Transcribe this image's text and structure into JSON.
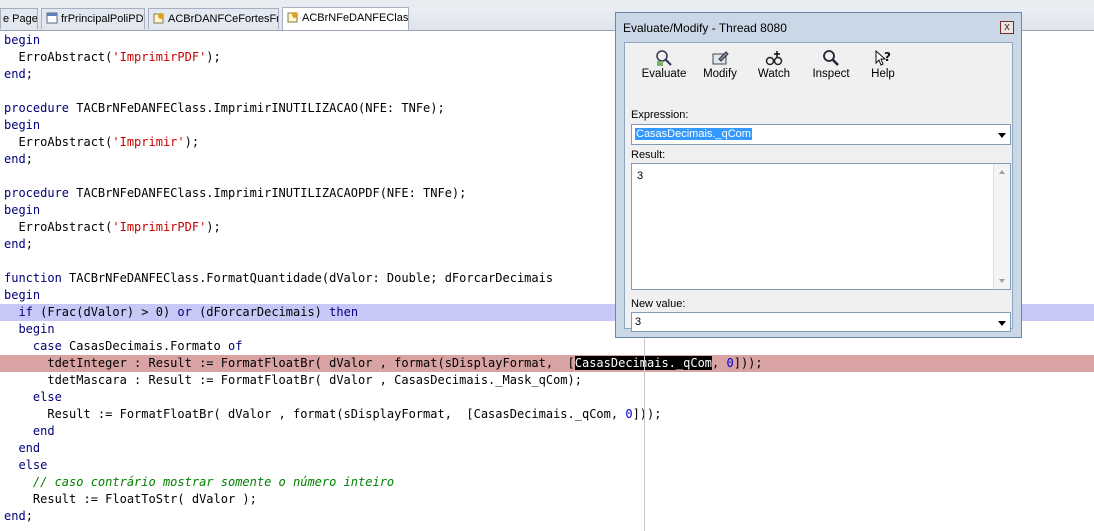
{
  "tabs": [
    {
      "label": "e Page",
      "icon": "none"
    },
    {
      "label": "frPrincipalPoliPDV",
      "icon": "form-icon"
    },
    {
      "label": "ACBrDANFCeFortesFr",
      "icon": "unit-icon"
    },
    {
      "label": "ACBrNFeDANFEClass",
      "icon": "unit-icon"
    }
  ],
  "code_lines": [
    [
      {
        "t": "begin",
        "c": "kw"
      }
    ],
    [
      {
        "t": "  ErroAbstract("
      },
      {
        "t": "'ImprimirPDF'",
        "c": "str"
      },
      {
        "t": ");"
      }
    ],
    [
      {
        "t": "end",
        "c": "kw"
      },
      {
        "t": ";"
      }
    ],
    [
      {
        "t": ""
      }
    ],
    [
      {
        "t": "procedure",
        "c": "kw"
      },
      {
        "t": " TACBrNFeDANFEClass.ImprimirINUTILIZACAO(NFE: TNFe);"
      }
    ],
    [
      {
        "t": "begin",
        "c": "kw"
      }
    ],
    [
      {
        "t": "  ErroAbstract("
      },
      {
        "t": "'Imprimir'",
        "c": "str"
      },
      {
        "t": ");"
      }
    ],
    [
      {
        "t": "end",
        "c": "kw"
      },
      {
        "t": ";"
      }
    ],
    [
      {
        "t": ""
      }
    ],
    [
      {
        "t": "procedure",
        "c": "kw"
      },
      {
        "t": " TACBrNFeDANFEClass.ImprimirINUTILIZACAOPDF(NFE: TNFe);"
      }
    ],
    [
      {
        "t": "begin",
        "c": "kw"
      }
    ],
    [
      {
        "t": "  ErroAbstract("
      },
      {
        "t": "'ImprimirPDF'",
        "c": "str"
      },
      {
        "t": ");"
      }
    ],
    [
      {
        "t": "end",
        "c": "kw"
      },
      {
        "t": ";"
      }
    ],
    [
      {
        "t": ""
      }
    ],
    [
      {
        "t": "function",
        "c": "kw"
      },
      {
        "t": " TACBrNFeDANFEClass.FormatQuantidade(dValor: Double; dForcarDecimais"
      }
    ],
    [
      {
        "t": "begin",
        "c": "kw"
      }
    ],
    [
      {
        "t": "  "
      },
      {
        "t": "if",
        "c": "kw"
      },
      {
        "t": " (Frac(dValor) > 0) "
      },
      {
        "t": "or",
        "c": "kw"
      },
      {
        "t": " (dForcarDecimais) "
      },
      {
        "t": "then",
        "c": "kw"
      }
    ],
    [
      {
        "t": "  "
      },
      {
        "t": "begin",
        "c": "kw"
      }
    ],
    [
      {
        "t": "    "
      },
      {
        "t": "case",
        "c": "kw"
      },
      {
        "t": " CasasDecimais.Formato "
      },
      {
        "t": "of",
        "c": "kw"
      }
    ],
    [
      {
        "t": "      tdetInteger : Result := FormatFloatBr( dValor , format(sDisplayFormat,  ["
      },
      {
        "t": "CasasDecimais._qCom",
        "c": "sel"
      },
      {
        "t": ", "
      },
      {
        "t": "0",
        "c": "num"
      },
      {
        "t": "]));"
      }
    ],
    [
      {
        "t": "      tdetMascara : Result := FormatFloatBr( dValor , CasasDecimais._Mask_qCom);"
      }
    ],
    [
      {
        "t": "    "
      },
      {
        "t": "else",
        "c": "kw"
      }
    ],
    [
      {
        "t": "      Result := FormatFloatBr( dValor , format(sDisplayFormat,  [CasasDecimais._qCom, "
      },
      {
        "t": "0",
        "c": "num"
      },
      {
        "t": "]));"
      }
    ],
    [
      {
        "t": "    "
      },
      {
        "t": "end",
        "c": "kw"
      }
    ],
    [
      {
        "t": "  "
      },
      {
        "t": "end",
        "c": "kw"
      }
    ],
    [
      {
        "t": "  "
      },
      {
        "t": "else",
        "c": "kw"
      }
    ],
    [
      {
        "t": "    "
      },
      {
        "t": "// caso contrário mostrar somente o número inteiro",
        "c": "cmt"
      }
    ],
    [
      {
        "t": "    Result := FloatToStr( dValor );"
      }
    ],
    [
      {
        "t": "end",
        "c": "kw"
      },
      {
        "t": ";"
      }
    ]
  ],
  "exec_line": 16,
  "breakpoint_line": 19,
  "dialog": {
    "title": "Evaluate/Modify - Thread 8080",
    "close": "x",
    "toolbar": [
      {
        "label": "Evaluate",
        "icon": "evaluate-icon"
      },
      {
        "label": "Modify",
        "icon": "modify-icon"
      },
      {
        "label": "Watch",
        "icon": "watch-icon"
      },
      {
        "label": "Inspect",
        "icon": "inspect-icon"
      },
      {
        "label": "Help",
        "icon": "help-icon"
      }
    ],
    "expression_label": "Expression:",
    "expression_value": "CasasDecimais._qCom",
    "result_label": "Result:",
    "result_value": "3",
    "new_value_label": "New value:",
    "new_value": "3"
  }
}
